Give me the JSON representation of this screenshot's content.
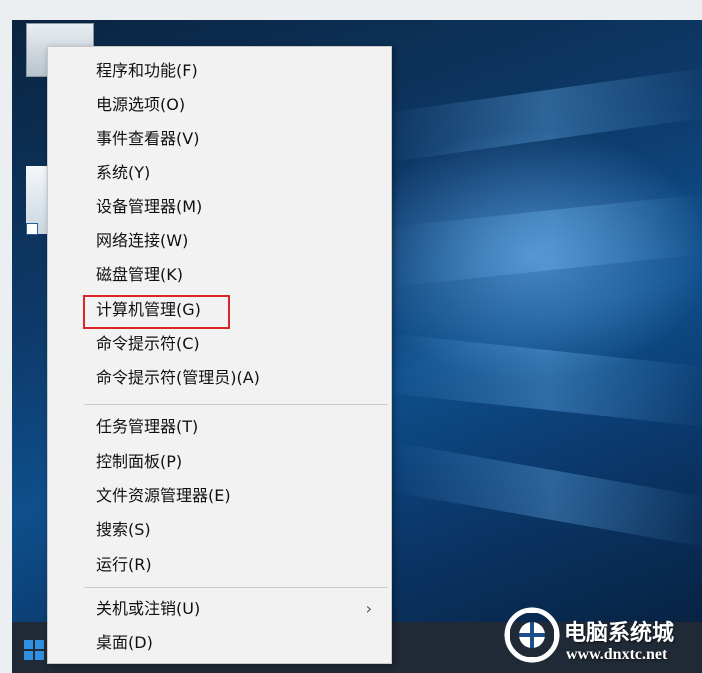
{
  "context_menu": {
    "group1": [
      {
        "label": "程序和功能(F)"
      },
      {
        "label": "电源选项(O)"
      },
      {
        "label": "事件查看器(V)"
      },
      {
        "label": "系统(Y)"
      },
      {
        "label": "设备管理器(M)"
      },
      {
        "label": "网络连接(W)"
      },
      {
        "label": "磁盘管理(K)"
      },
      {
        "label": "计算机管理(G)"
      },
      {
        "label": "命令提示符(C)"
      },
      {
        "label": "命令提示符(管理员)(A)"
      }
    ],
    "group2": [
      {
        "label": "任务管理器(T)"
      },
      {
        "label": "控制面板(P)"
      },
      {
        "label": "文件资源管理器(E)"
      },
      {
        "label": "搜索(S)"
      },
      {
        "label": "运行(R)"
      }
    ],
    "group3": [
      {
        "label": "关机或注销(U)",
        "submenu_arrow": "›"
      },
      {
        "label": "桌面(D)"
      }
    ],
    "highlight_color": "#d8262b"
  },
  "watermark": {
    "title": "电脑系统城",
    "url": "www.dnxtc.net"
  },
  "colors": {
    "start_icon": "#2f8fe0",
    "taskbar": "#202a36"
  }
}
